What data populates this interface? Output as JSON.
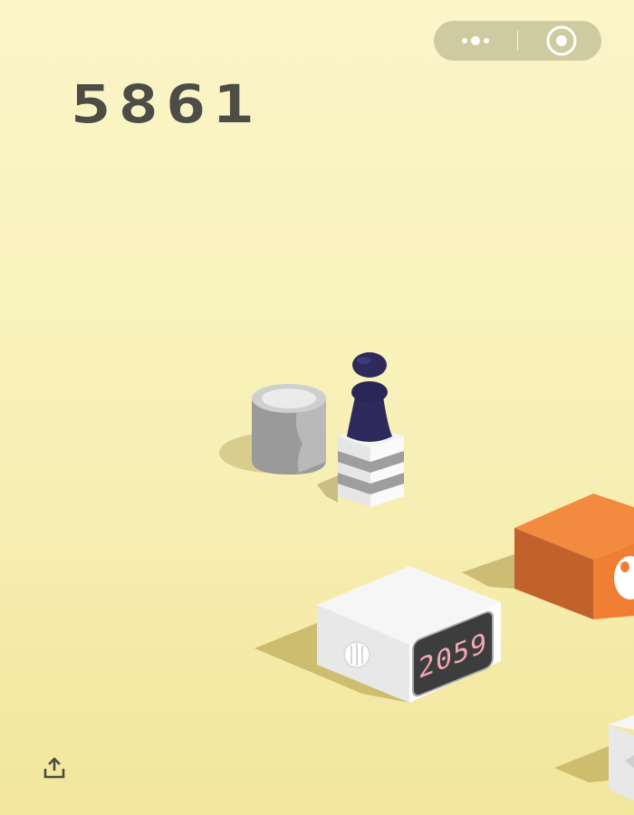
{
  "score": "5861",
  "clock": {
    "time": "2059"
  },
  "icons": {
    "more": "more-dots-icon",
    "close": "target-close-icon",
    "share": "share-upload-icon"
  },
  "colors": {
    "background": "#f7f0b6",
    "score": "#4d4d47",
    "player": "#2e2a5c",
    "orange_block": "#f07f33",
    "clock_display": "#f2a7b4"
  }
}
